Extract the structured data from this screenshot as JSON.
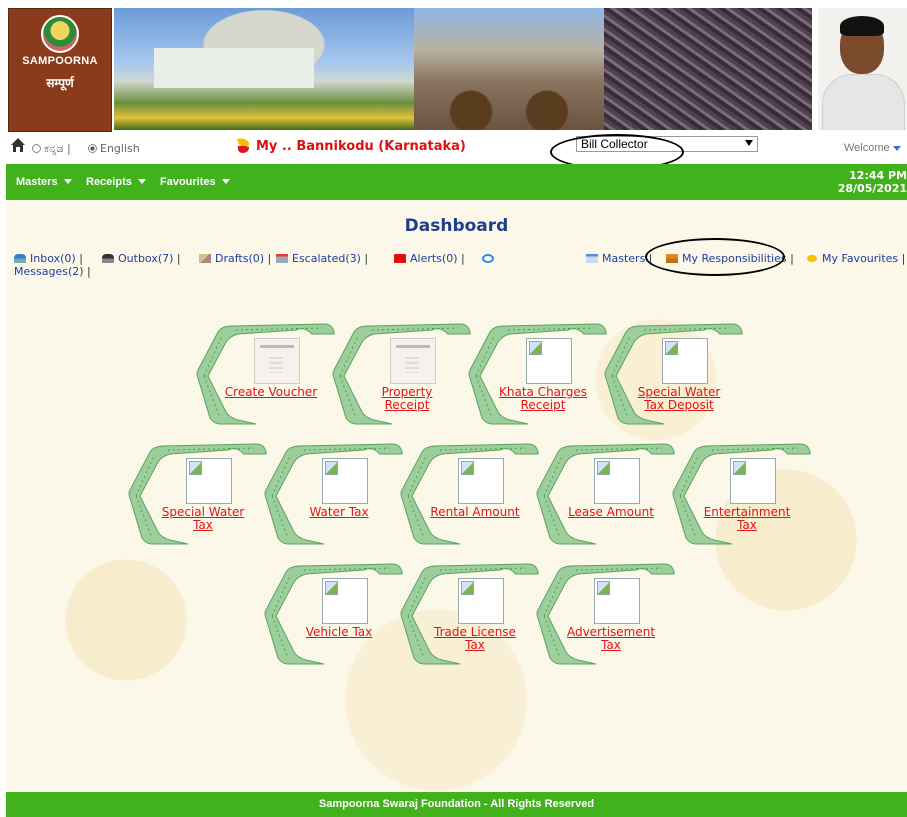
{
  "header": {
    "logo_brand": "SAMPOORNA",
    "logo_hindi": "सम्पूर्ण"
  },
  "langbar": {
    "lang_kannada": "ಕನ್ನಡ",
    "lang_english": "English",
    "place_title": "My .. Bannikodu (Karnataka)",
    "role_value": "Bill Collector",
    "welcome": "Welcome"
  },
  "menu": {
    "items": [
      "Masters",
      "Receipts",
      "Favourites"
    ],
    "time": "12:44 PM",
    "date": "28/05/2021"
  },
  "dashboard": {
    "title": "Dashboard",
    "toolbar": {
      "inbox": "Inbox(0)",
      "outbox": "Outbox(7)",
      "drafts": "Drafts(0)",
      "escalated": "Escalated(3)",
      "alerts": "Alerts(0)",
      "messages": "Messages(2)",
      "masters": "Masters",
      "responsibilities": "My Responsibilities",
      "favourites": "My Favourites"
    },
    "tiles": [
      {
        "line1": "Create Voucher",
        "line2": ""
      },
      {
        "line1": "Property",
        "line2": "Receipt"
      },
      {
        "line1": "Khata Charges",
        "line2": "Receipt"
      },
      {
        "line1": "Special Water",
        "line2": "Tax Deposit"
      },
      {
        "line1": "Special Water",
        "line2": "Tax"
      },
      {
        "line1": "Water Tax",
        "line2": ""
      },
      {
        "line1": "Rental Amount",
        "line2": ""
      },
      {
        "line1": "Lease Amount",
        "line2": ""
      },
      {
        "line1": "Entertainment",
        "line2": "Tax"
      },
      {
        "line1": "Vehicle Tax",
        "line2": ""
      },
      {
        "line1": "Trade License",
        "line2": "Tax"
      },
      {
        "line1": "Advertisement",
        "line2": "Tax"
      }
    ]
  },
  "footer": {
    "text": "Sampoorna Swaraj Foundation - All Rights Reserved"
  },
  "colors": {
    "menu_green": "#41b21c",
    "link_red": "#e01616",
    "title_blue": "#1f3f8c"
  }
}
